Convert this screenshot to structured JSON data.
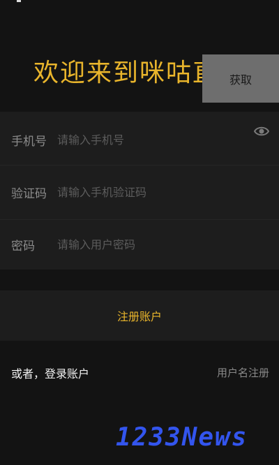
{
  "header": {
    "title": "欢迎来到咪咕直播"
  },
  "form": {
    "phone": {
      "label": "手机号",
      "placeholder": "请输入手机号"
    },
    "code": {
      "label": "验证码",
      "placeholder": "请输入手机验证码",
      "get_button": "获取"
    },
    "password": {
      "label": "密码",
      "placeholder": "请输入用户密码",
      "toggle_icon": "eye-icon"
    }
  },
  "actions": {
    "register": "注册账户",
    "login_alt": "或者，登录账户",
    "username_register": "用户名注册"
  },
  "watermark": "1233News",
  "colors": {
    "accent": "#e9b52c",
    "background": "#131313",
    "panel": "#1d1d1d",
    "button": "#6e6e6e",
    "watermark": "#3355ee"
  }
}
